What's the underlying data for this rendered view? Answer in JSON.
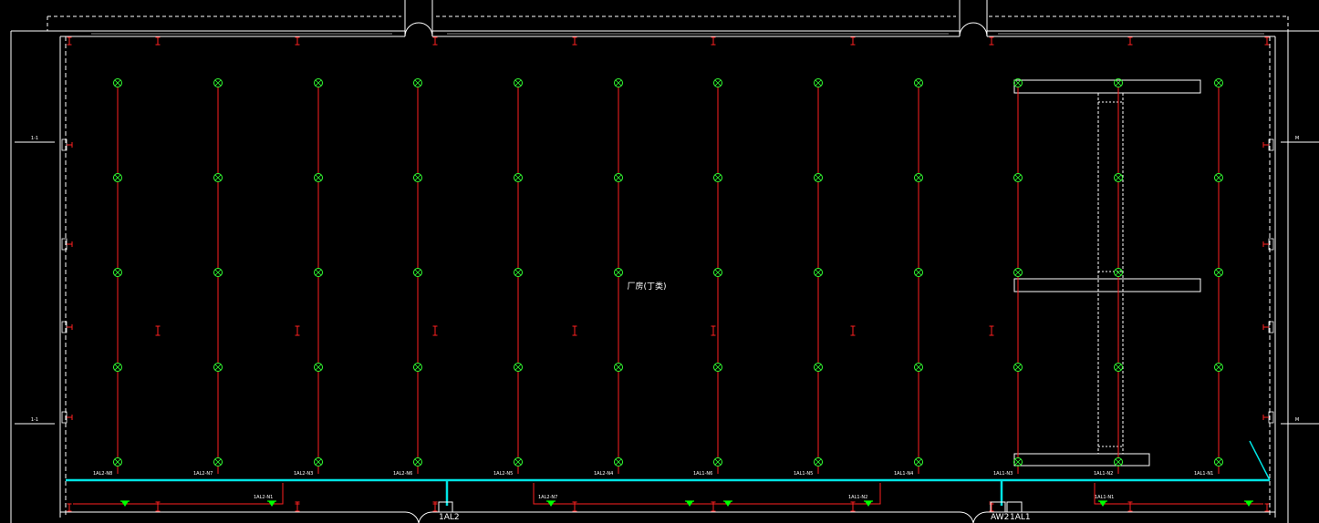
{
  "drawing": {
    "room_name": "厂房(丁类)",
    "room_sub": "",
    "panels": {
      "left": "1AL2",
      "right_a": "AW2",
      "right_b": "1AL1"
    },
    "circuits": [
      "1AL2-N8",
      "1AL2-N7",
      "1AL2-N3",
      "1AL2-N6",
      "1AL2-N5",
      "1AL2-N4",
      "1AL1-N6",
      "1AL1-N5",
      "1AL1-N4",
      "1AL1-N3",
      "1AL1-N2",
      "1AL1-N1"
    ],
    "lower_circuits": [
      "1AL2-N1",
      "1AL2-N7",
      "1AL1-N2",
      "1AL1-N1"
    ],
    "left_marks": [
      "1-1",
      "1-1"
    ],
    "right_marks": [
      "M",
      "M"
    ],
    "tray_note_line1": "",
    "tray_note_line2": "",
    "crane_beam_label": ""
  },
  "colors": {
    "background": "#000000",
    "wall": "#ffffff",
    "wiring": "#ff2020",
    "fixture": "#33ff33",
    "cable_tray": "#00e5e5",
    "emergency": "#00ff00",
    "text": "#ffffff"
  },
  "icons": {
    "fixture": "circle-cross-lamp-icon",
    "exit": "emergency-light-icon",
    "socket": "i-beam-socket-icon"
  }
}
